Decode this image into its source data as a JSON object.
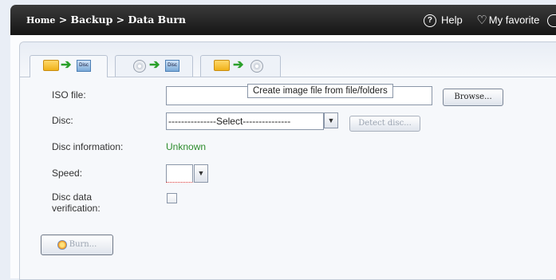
{
  "header": {
    "breadcrumb_home": "Home",
    "breadcrumb_rest": "> Backup > Data Burn",
    "help_label": "Help",
    "favorite_label": "My favorite",
    "help_icon": "?",
    "heart_icon": "♡"
  },
  "tabs": [
    {
      "name": "tab-files-to-disc"
    },
    {
      "name": "tab-image-to-disc"
    },
    {
      "name": "tab-create-image"
    }
  ],
  "tooltip": "Create image file from file/folders",
  "form": {
    "iso_label": "ISO file:",
    "iso_value": "",
    "browse_label": "Browse...",
    "disc_label": "Disc:",
    "disc_selected": "---------------Select---------------",
    "detect_label": "Detect disc...",
    "discinfo_label": "Disc information:",
    "discinfo_value": "Unknown",
    "speed_label": "Speed:",
    "speed_value": "",
    "verify_label": "Disc data verification:",
    "burn_label": "Burn..."
  },
  "colors": {
    "accent_green": "#2d8c2d",
    "header_bg": "#1e1e1e"
  }
}
